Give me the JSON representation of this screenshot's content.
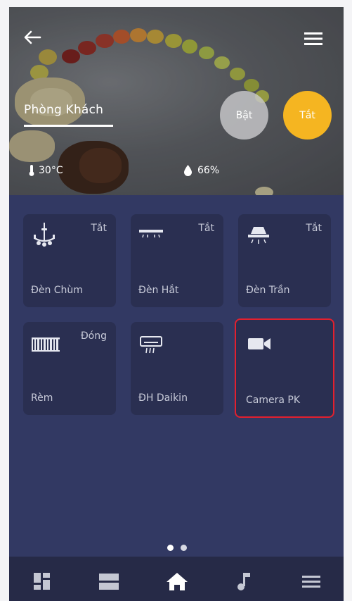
{
  "header": {
    "room_title": "Phòng Khách",
    "on_button": "Bật",
    "off_button": "Tắt",
    "temperature": "30°C",
    "humidity": "66%"
  },
  "devices": [
    {
      "label": "Đèn Chùm",
      "status": "Tắt",
      "icon": "chandelier-icon"
    },
    {
      "label": "Đèn Hắt",
      "status": "Tắt",
      "icon": "cove-light-icon"
    },
    {
      "label": "Đèn Trần",
      "status": "Tắt",
      "icon": "ceiling-light-icon"
    },
    {
      "label": "Rèm",
      "status": "Đóng",
      "icon": "curtain-icon"
    },
    {
      "label": "ĐH Daikin",
      "status": "",
      "icon": "air-conditioner-icon"
    },
    {
      "label": "Camera PK",
      "status": "",
      "icon": "camera-icon"
    }
  ],
  "pager": {
    "current": 1,
    "total": 2
  },
  "bottom_nav": [
    "dashboard-icon",
    "list-view-icon",
    "home-icon",
    "music-icon",
    "menu-icon"
  ],
  "colors": {
    "background": "#323963",
    "card": "#2a2f51",
    "nav": "#262a47",
    "accent": "#f5b521",
    "selected": "#e3202e"
  }
}
